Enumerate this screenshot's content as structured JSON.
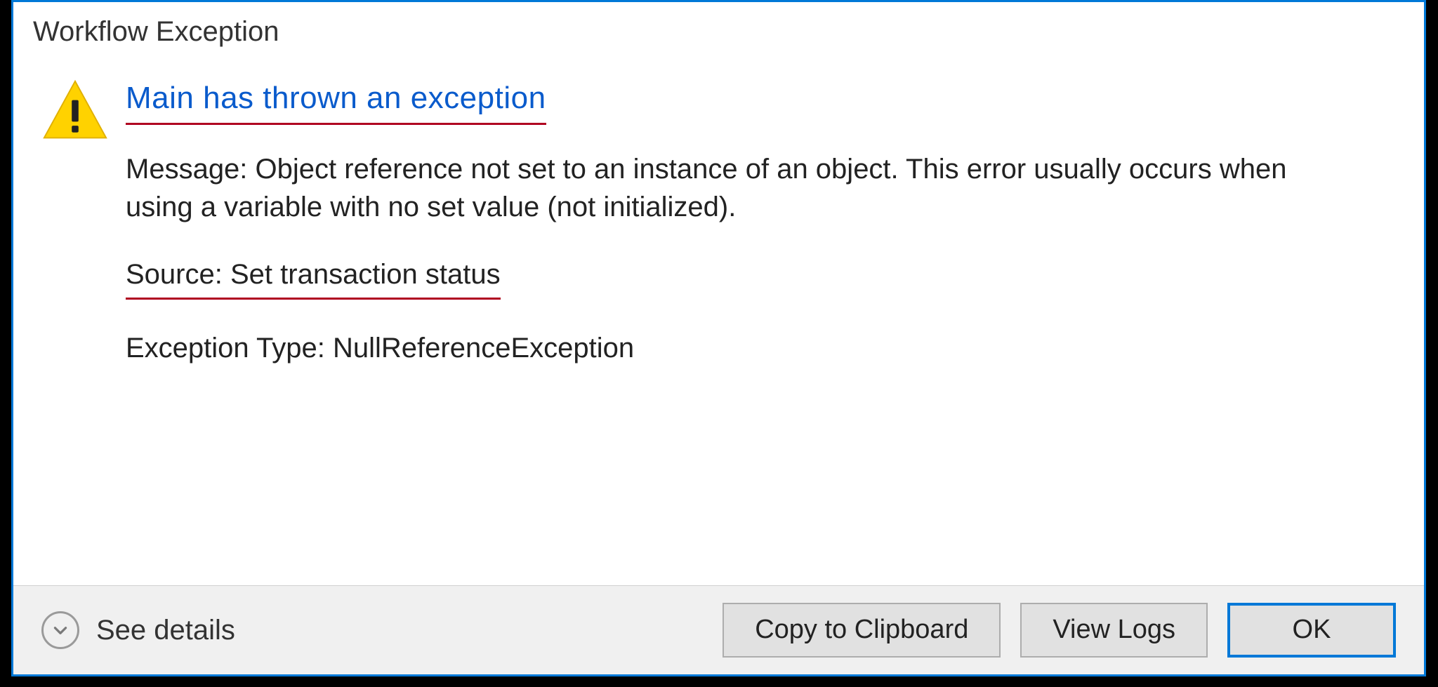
{
  "dialog": {
    "title": "Workflow Exception",
    "heading": "Main has thrown an exception",
    "message_label": "Message:",
    "message_text": "Object reference not set to an instance of an object. This error usually occurs when using a variable with no set value (not initialized).",
    "source_label": "Source:",
    "source_value": "Set transaction status",
    "exception_type_label": "Exception Type:",
    "exception_type_value": "NullReferenceException"
  },
  "footer": {
    "see_details_label": "See details",
    "copy_label": "Copy to Clipboard",
    "view_logs_label": "View Logs",
    "ok_label": "OK"
  },
  "colors": {
    "accent_blue": "#0078d7",
    "heading_blue": "#0a5bcc",
    "underline_red": "#b00020",
    "warning_yellow": "#ffd200"
  }
}
